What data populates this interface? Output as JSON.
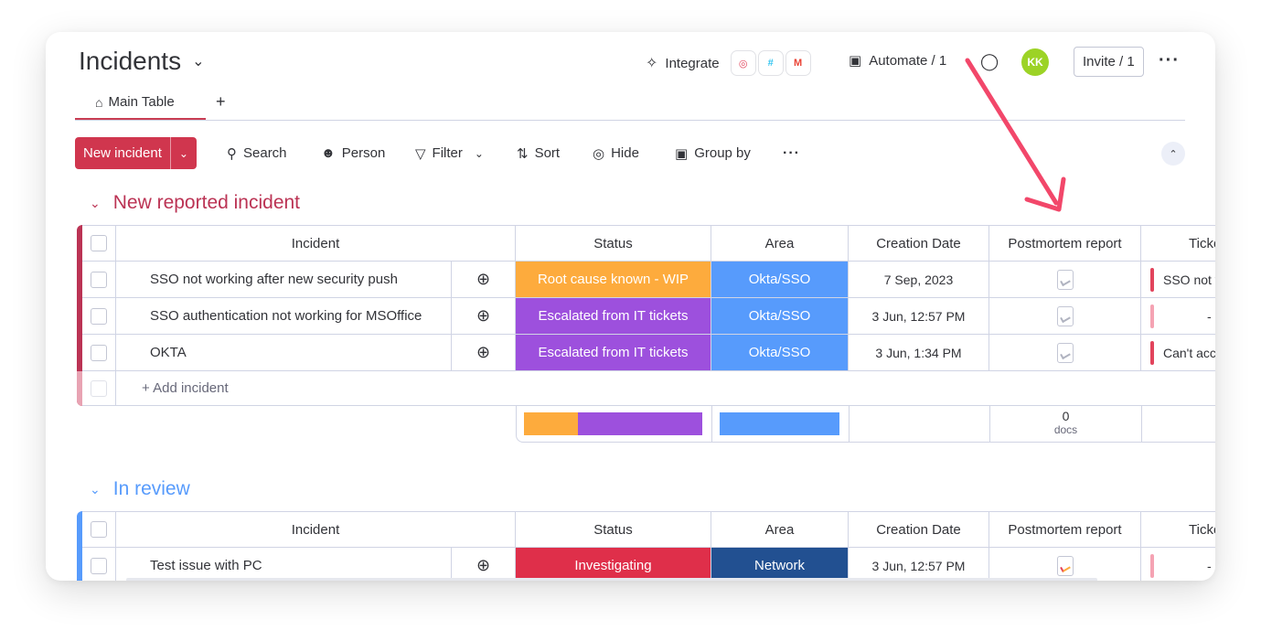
{
  "header": {
    "board_title": "Incidents",
    "integrate_label": "Integrate",
    "automate_label": "Automate / 1",
    "avatar_initials": "KK",
    "invite_label": "Invite / 1"
  },
  "tabs": {
    "main_table": "Main Table",
    "add": "+"
  },
  "toolbar": {
    "new_item": "New incident",
    "search": "Search",
    "person": "Person",
    "filter": "Filter",
    "sort": "Sort",
    "hide": "Hide",
    "group_by": "Group by"
  },
  "columns": {
    "incident": "Incident",
    "status": "Status",
    "area": "Area",
    "creation_date": "Creation Date",
    "postmortem": "Postmortem report",
    "tickets": "Ticke"
  },
  "groups": [
    {
      "title": "New reported incident",
      "color": "#bb3354",
      "rows": [
        {
          "name": "SSO not working after new security push",
          "status": "Root cause known - WIP",
          "status_color": "#fdab3d",
          "area": "Okta/SSO",
          "area_color": "#579bfc",
          "date": "7 Sep, 2023",
          "ticket": "SSO not w"
        },
        {
          "name": "SSO authentication not working for MSOffice",
          "status": "Escalated from IT tickets",
          "status_color": "#9d50dd",
          "area": "Okta/SSO",
          "area_color": "#579bfc",
          "date": "3 Jun, 12:57 PM",
          "ticket": "-"
        },
        {
          "name": "OKTA",
          "status": "Escalated from IT tickets",
          "status_color": "#9d50dd",
          "area": "Okta/SSO",
          "area_color": "#579bfc",
          "date": "3 Jun, 1:34 PM",
          "ticket": "Can't acc"
        }
      ],
      "add_label": "+ Add incident",
      "summary": {
        "docs_count": "0",
        "docs_label": "docs",
        "status_split": [
          0.3,
          0.7
        ]
      }
    },
    {
      "title": "In review",
      "color": "#579bfc",
      "rows": [
        {
          "name": "Test issue with PC",
          "status": "Investigating",
          "status_color": "#df2f4a",
          "area": "Network",
          "area_color": "#225091",
          "date": "3 Jun, 12:57 PM",
          "ticket": "-"
        }
      ]
    }
  ]
}
